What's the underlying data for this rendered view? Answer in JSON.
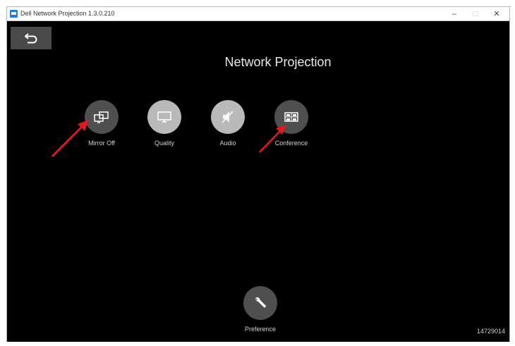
{
  "window": {
    "title": "Dell Network Projection 1.3.0.210",
    "minimize": "–",
    "maximize": "□",
    "close": "✕"
  },
  "header": {
    "title": "Network Projection"
  },
  "features": [
    {
      "label": "Mirror Off",
      "icon": "mirror-icon"
    },
    {
      "label": "Quality",
      "icon": "monitor-icon"
    },
    {
      "label": "Audio",
      "icon": "audio-mute-icon"
    },
    {
      "label": "Conference",
      "icon": "conference-icon"
    }
  ],
  "preference": {
    "label": "Preference",
    "icon": "wrench-icon"
  },
  "footer": {
    "version": "14729014"
  },
  "colors": {
    "background": "#000000",
    "button_dark": "#4f4f4f",
    "button_light": "#b9b9b9",
    "annotation_arrow": "#e0191f",
    "title_icon": "#1e7fd6"
  }
}
